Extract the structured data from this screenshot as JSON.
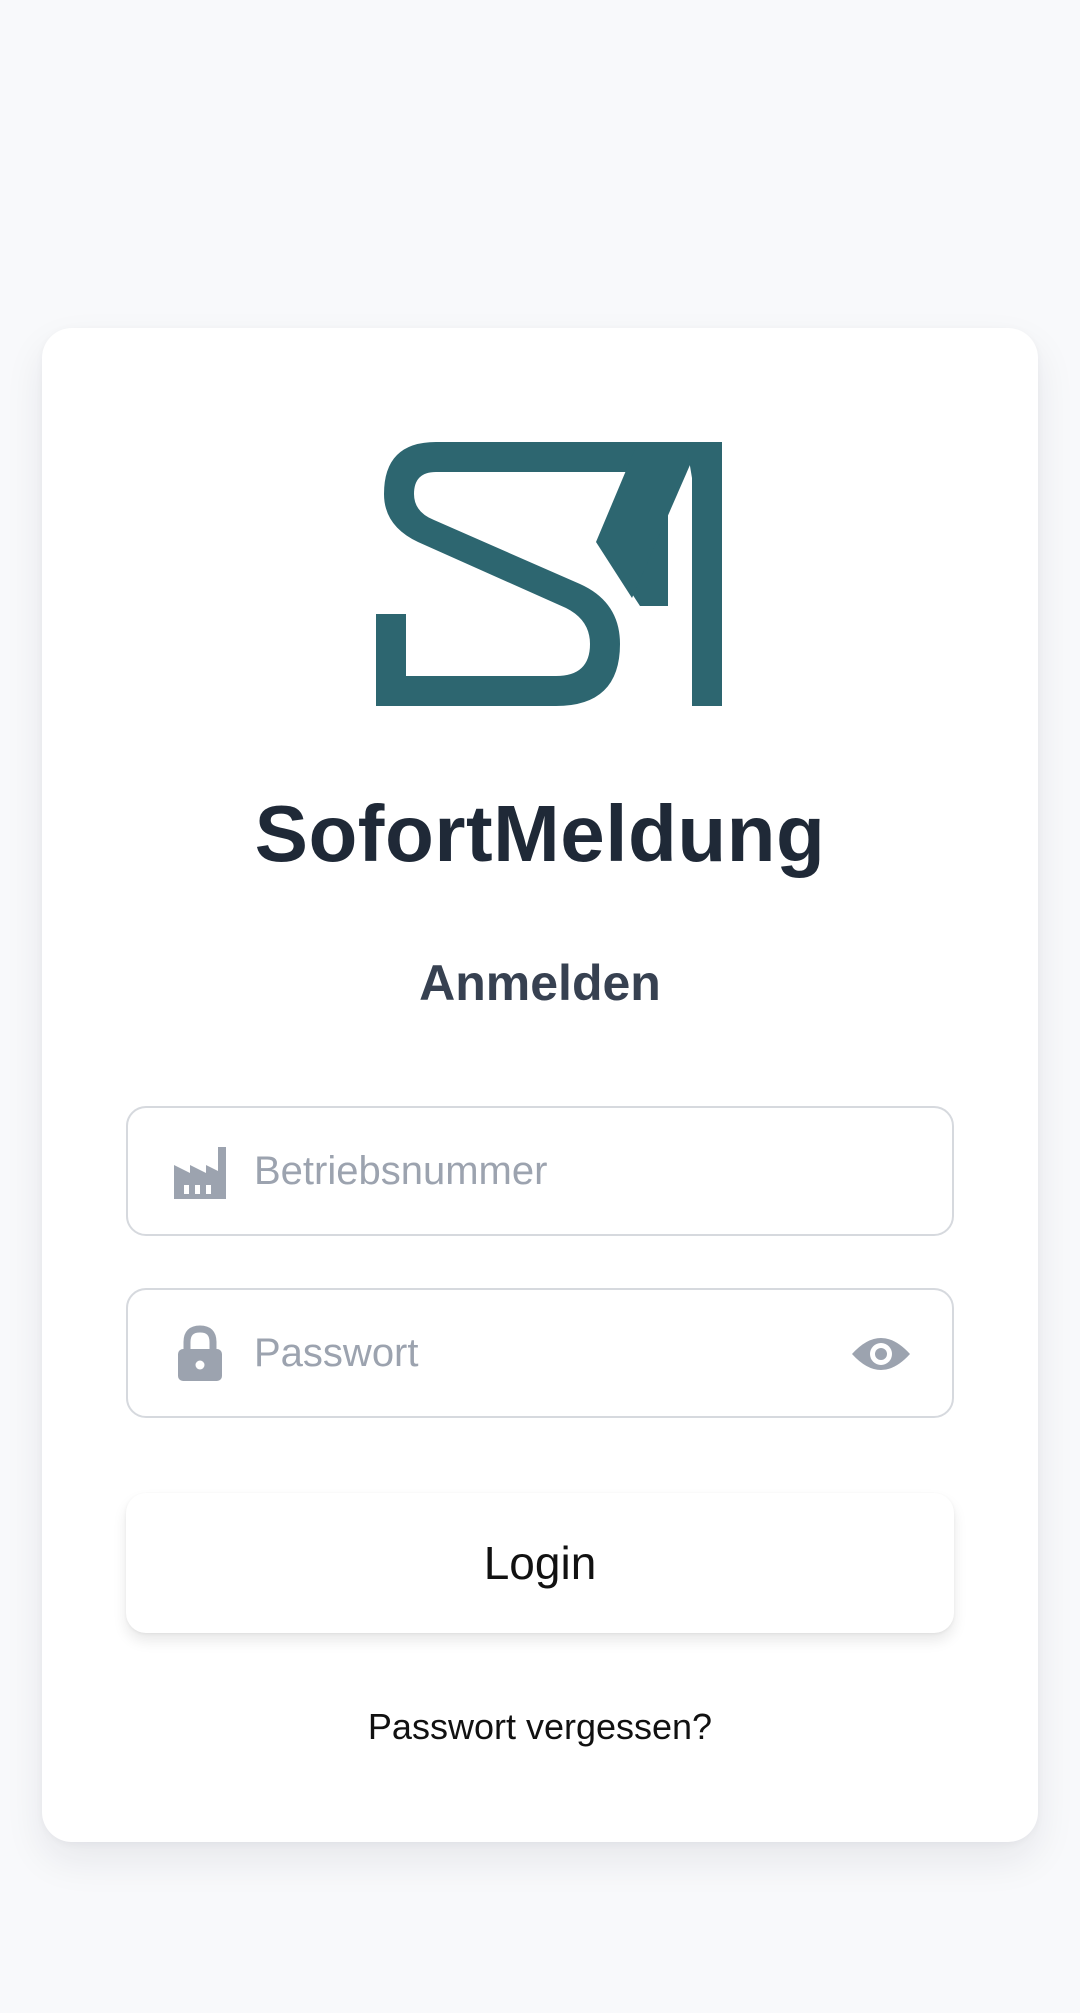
{
  "brand": {
    "logo_icon": "sm-logo-icon",
    "logo_letters": "SM",
    "app_name": "SofortMeldung",
    "accent_color": "#2d6670"
  },
  "login_form": {
    "heading": "Anmelden",
    "company_field": {
      "icon": "factory-icon",
      "placeholder": "Betriebsnummer",
      "value": ""
    },
    "password_field": {
      "icon": "lock-icon",
      "placeholder": "Passwort",
      "value": "",
      "toggle_icon": "eye-icon"
    },
    "login_label": "Login",
    "forgot_password_label": "Passwort vergessen?"
  },
  "colors": {
    "background": "#f8f9fb",
    "card": "#ffffff",
    "title_text": "#1f2937",
    "icon_gray": "#9ca3af",
    "placeholder_gray": "#9ca3af"
  }
}
